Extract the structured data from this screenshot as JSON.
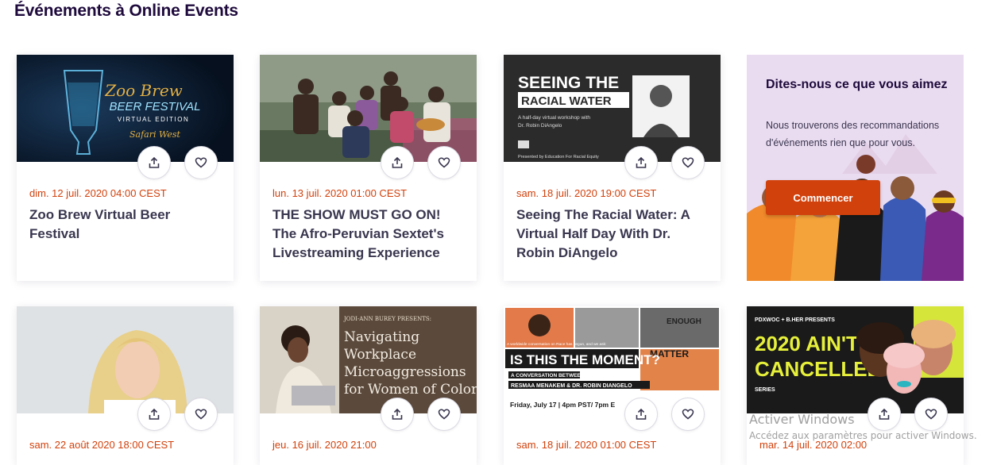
{
  "page": {
    "title": "Événements à Online Events"
  },
  "events_row1": [
    {
      "date": "dim. 12 juil. 2020 04:00 CEST",
      "title": "Zoo Brew Virtual Beer Festival",
      "image_text": {
        "line1": "Zoo Brew",
        "line2": "BEER FESTIVAL",
        "line3": "VIRTUAL EDITION",
        "line4": "Safari West"
      }
    },
    {
      "date": "lun. 13 juil. 2020 01:00 CEST",
      "title": "THE SHOW MUST GO ON! The Afro-Peruvian Sextet's Livestreaming Experience"
    },
    {
      "date": "sam. 18 juil. 2020 19:00 CEST",
      "title": "Seeing The Racial Water: A Virtual Half Day With Dr. Robin DiAngelo",
      "image_text": {
        "line1": "SEEING THE",
        "line2": "RACIAL WATER",
        "line3": "A half-day virtual workshop with",
        "line4": "Dr. Robin DiAngelo",
        "line5": "Presented by Education For Racial Equity"
      }
    }
  ],
  "promo": {
    "heading": "Dites-nous ce que vous aimez",
    "text": "Nous trouverons des recommandations d'événements rien que pour vous.",
    "button": "Commencer"
  },
  "events_row2": [
    {
      "date": "sam. 22 août 2020 18:00 CEST"
    },
    {
      "date": "jeu. 16 juil. 2020 21:00",
      "image_text": {
        "line1": "JODI-ANN BUREY PRESENTS:",
        "line2": "Navigating",
        "line3": "Workplace",
        "line4": "Microaggressions",
        "line5": "for Women of Color"
      }
    },
    {
      "date": "sam. 18 juil. 2020 01:00 CEST",
      "image_text": {
        "line1": "A worldwide conversation on Race has begun, and we ask:",
        "line2": "IS THIS THE MOMENT?",
        "line3": "A CONVERSATION BETWEEN",
        "line4": "RESMAA MENAKEM & DR. ROBIN DIANGELO",
        "line5": "Friday, July 17 | 4pm PST/ 7pm E",
        "line6": "ENOUGH",
        "line7": "MATTER"
      }
    },
    {
      "date": "mar. 14 juil. 2020 02:00",
      "image_text": {
        "line1": "PDXWOC + B.HER PRESENTS",
        "line2": "2020 AIN'T",
        "line3": "CANCELLED !",
        "line4": "SERIES"
      }
    }
  ],
  "watermark": {
    "line1": "Activer Windows",
    "line2": "Accédez aux paramètres pour activer Windows."
  },
  "colors": {
    "accent": "#d1410c",
    "title": "#1e0a3c",
    "promo_bg": "#eadcf0"
  },
  "icons": {
    "share": "share-icon",
    "like": "heart-icon"
  }
}
